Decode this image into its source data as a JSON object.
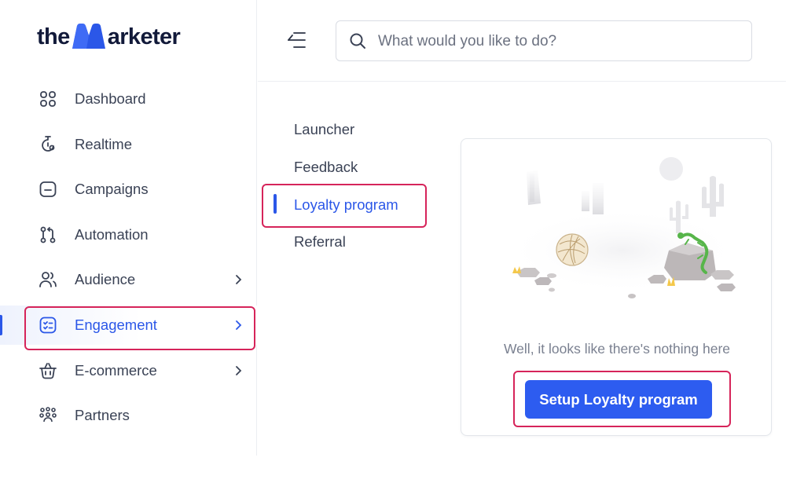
{
  "brand": {
    "logo_prefix": "the",
    "logo_suffix": "arketer",
    "logo_m": "M"
  },
  "sidebar": {
    "items": [
      {
        "label": "Dashboard",
        "icon": "grid-icon",
        "has_chevron": false
      },
      {
        "label": "Realtime",
        "icon": "stopwatch-icon",
        "has_chevron": false
      },
      {
        "label": "Campaigns",
        "icon": "folder-icon",
        "has_chevron": false
      },
      {
        "label": "Automation",
        "icon": "flow-icon",
        "has_chevron": false
      },
      {
        "label": "Audience",
        "icon": "users-icon",
        "has_chevron": true
      },
      {
        "label": "Engagement",
        "icon": "checklist-icon",
        "has_chevron": true,
        "active": true
      },
      {
        "label": "E-commerce",
        "icon": "basket-icon",
        "has_chevron": true
      },
      {
        "label": "Partners",
        "icon": "partners-icon",
        "has_chevron": false
      }
    ]
  },
  "header": {
    "search": {
      "placeholder": "What would you like to do?",
      "value": ""
    }
  },
  "subnav": {
    "items": [
      {
        "label": "Launcher"
      },
      {
        "label": "Feedback"
      },
      {
        "label": "Loyalty program",
        "active": true
      },
      {
        "label": "Referral"
      }
    ]
  },
  "empty_state": {
    "message": "Well, it looks like there's nothing here",
    "cta_label": "Setup Loyalty program"
  },
  "colors": {
    "accent": "#2b57e8",
    "highlight_outline": "#d6245a",
    "text": "#3a4255"
  }
}
